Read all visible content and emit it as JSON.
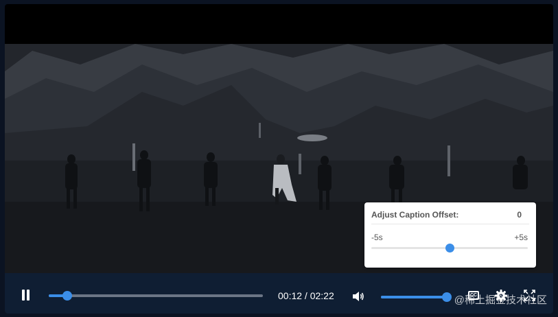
{
  "player": {
    "is_playing": true,
    "progress_percent": 8.5,
    "current_time": "00:12",
    "separator": " / ",
    "duration": "02:22",
    "volume_percent": 100,
    "cc_label": "CC",
    "accent_color": "#3b8ee8"
  },
  "caption_offset": {
    "title": "Adjust Caption Offset:",
    "value": "0",
    "min_label": "-5s",
    "max_label": "+5s",
    "slider_percent": 50
  },
  "watermark": "@稀土掘金技术社区",
  "icons": {
    "play_pause": "pause-icon",
    "volume": "volume-icon",
    "captions": "cc-icon",
    "settings": "gear-icon",
    "fullscreen": "fullscreen-icon"
  }
}
